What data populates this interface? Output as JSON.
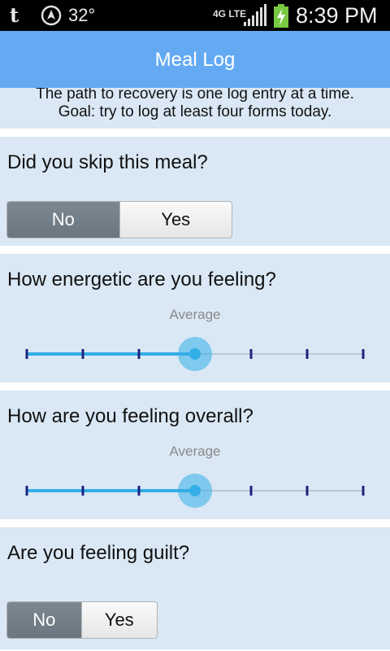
{
  "status_bar": {
    "carrier_icon_text": "t",
    "temperature": "32°",
    "network": "4G LTE",
    "time": "8:39 PM"
  },
  "app_bar": {
    "title": "Meal Log"
  },
  "intro": {
    "line1": "The path to recovery is one log entry at a time.",
    "line2": "Goal: try to log at least four forms today."
  },
  "questions": [
    {
      "title": "Did you skip this meal?",
      "type": "toggle",
      "options": [
        "No",
        "Yes"
      ],
      "selected": "No"
    },
    {
      "title": "How energetic are you feeling?",
      "type": "slider",
      "value_label": "Average",
      "steps": 7,
      "value_index": 3
    },
    {
      "title": "How are you feeling overall?",
      "type": "slider",
      "value_label": "Average",
      "steps": 7,
      "value_index": 3
    },
    {
      "title": "Are you feeling guilt?",
      "type": "toggle",
      "options": [
        "No",
        "Yes"
      ],
      "selected": "No"
    }
  ],
  "colors": {
    "app_bar": "#63aaf3",
    "card_background": "#dae8f5",
    "slider_accent": "#33aee6",
    "slider_tick": "#1a237e"
  }
}
